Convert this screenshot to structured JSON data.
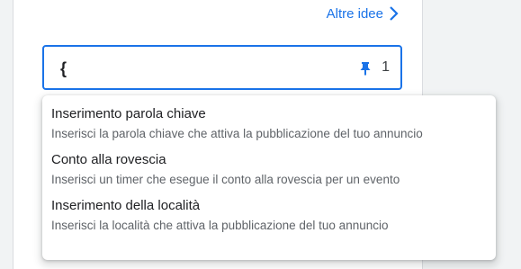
{
  "header": {
    "more_ideas_label": "Altre idee",
    "chevron_icon": "chevron-right-icon"
  },
  "input": {
    "value": "",
    "caret_char": "{",
    "pin_icon": "pin-icon",
    "counter": "1"
  },
  "menu": {
    "items": [
      {
        "title": "Inserimento parola chiave",
        "description": "Inserisci la parola chiave che attiva la pubblicazione del tuo annuncio"
      },
      {
        "title": "Conto alla rovescia",
        "description": "Inserisci un timer che esegue il conto alla rovescia per un evento"
      },
      {
        "title": "Inserimento della località",
        "description": "Inserisci la località che attiva la pubblicazione del tuo annuncio"
      }
    ]
  },
  "colors": {
    "accent": "#1a73e8",
    "text_primary": "#202124",
    "text_secondary": "#5f6368"
  }
}
